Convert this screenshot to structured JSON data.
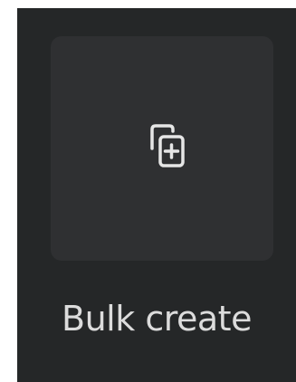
{
  "tool": {
    "label": "Bulk create",
    "icon": "bulk-create-icon"
  },
  "colors": {
    "background": "#252728",
    "tile": "#2f3032",
    "icon": "#e6e6e6",
    "label": "#dcdcdc"
  }
}
